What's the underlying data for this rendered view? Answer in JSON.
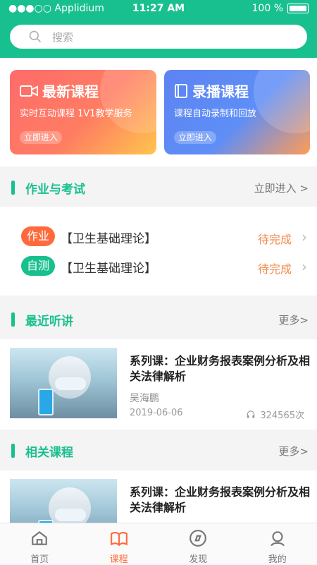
{
  "status": {
    "carrier": "●●●○○ Applidium",
    "time": "11:27 AM",
    "battery": "100 %"
  },
  "search": {
    "placeholder": "搜索"
  },
  "banners": [
    {
      "title": "最新课程",
      "subtitle": "实时互动课程  1V1教学服务",
      "button": "立即进入",
      "icon": "video-camera-icon"
    },
    {
      "title": "录播课程",
      "subtitle": "课程自动录制和回放",
      "button": "立即进入",
      "icon": "book-icon"
    }
  ],
  "homework": {
    "header": "作业与考试",
    "more": "立即进入 >",
    "rows": [
      {
        "tag": "作业",
        "title": "【卫生基础理论】",
        "status": "待完成"
      },
      {
        "tag": "自测",
        "title": "【卫生基础理论】",
        "status": "待完成"
      }
    ]
  },
  "recent": {
    "header": "最近听讲",
    "more": "更多>",
    "course": {
      "title": "系列课：企业财务报表案例分析及相关法律解析",
      "author": "吴海鹏",
      "date": "2019-06-06",
      "views": "324565次"
    }
  },
  "related": {
    "header": "相关课程",
    "more": "更多>",
    "course": {
      "title": "系列课：企业财务报表案例分析及相关法律解析"
    }
  },
  "tabs": [
    {
      "label": "首页",
      "icon": "home-icon"
    },
    {
      "label": "课程",
      "icon": "course-book-icon",
      "active": true
    },
    {
      "label": "发现",
      "icon": "compass-icon"
    },
    {
      "label": "我的",
      "icon": "profile-icon"
    }
  ],
  "colors": {
    "primary": "#19c08f",
    "accent": "#ff6a3c",
    "pending": "#f58a4a"
  }
}
